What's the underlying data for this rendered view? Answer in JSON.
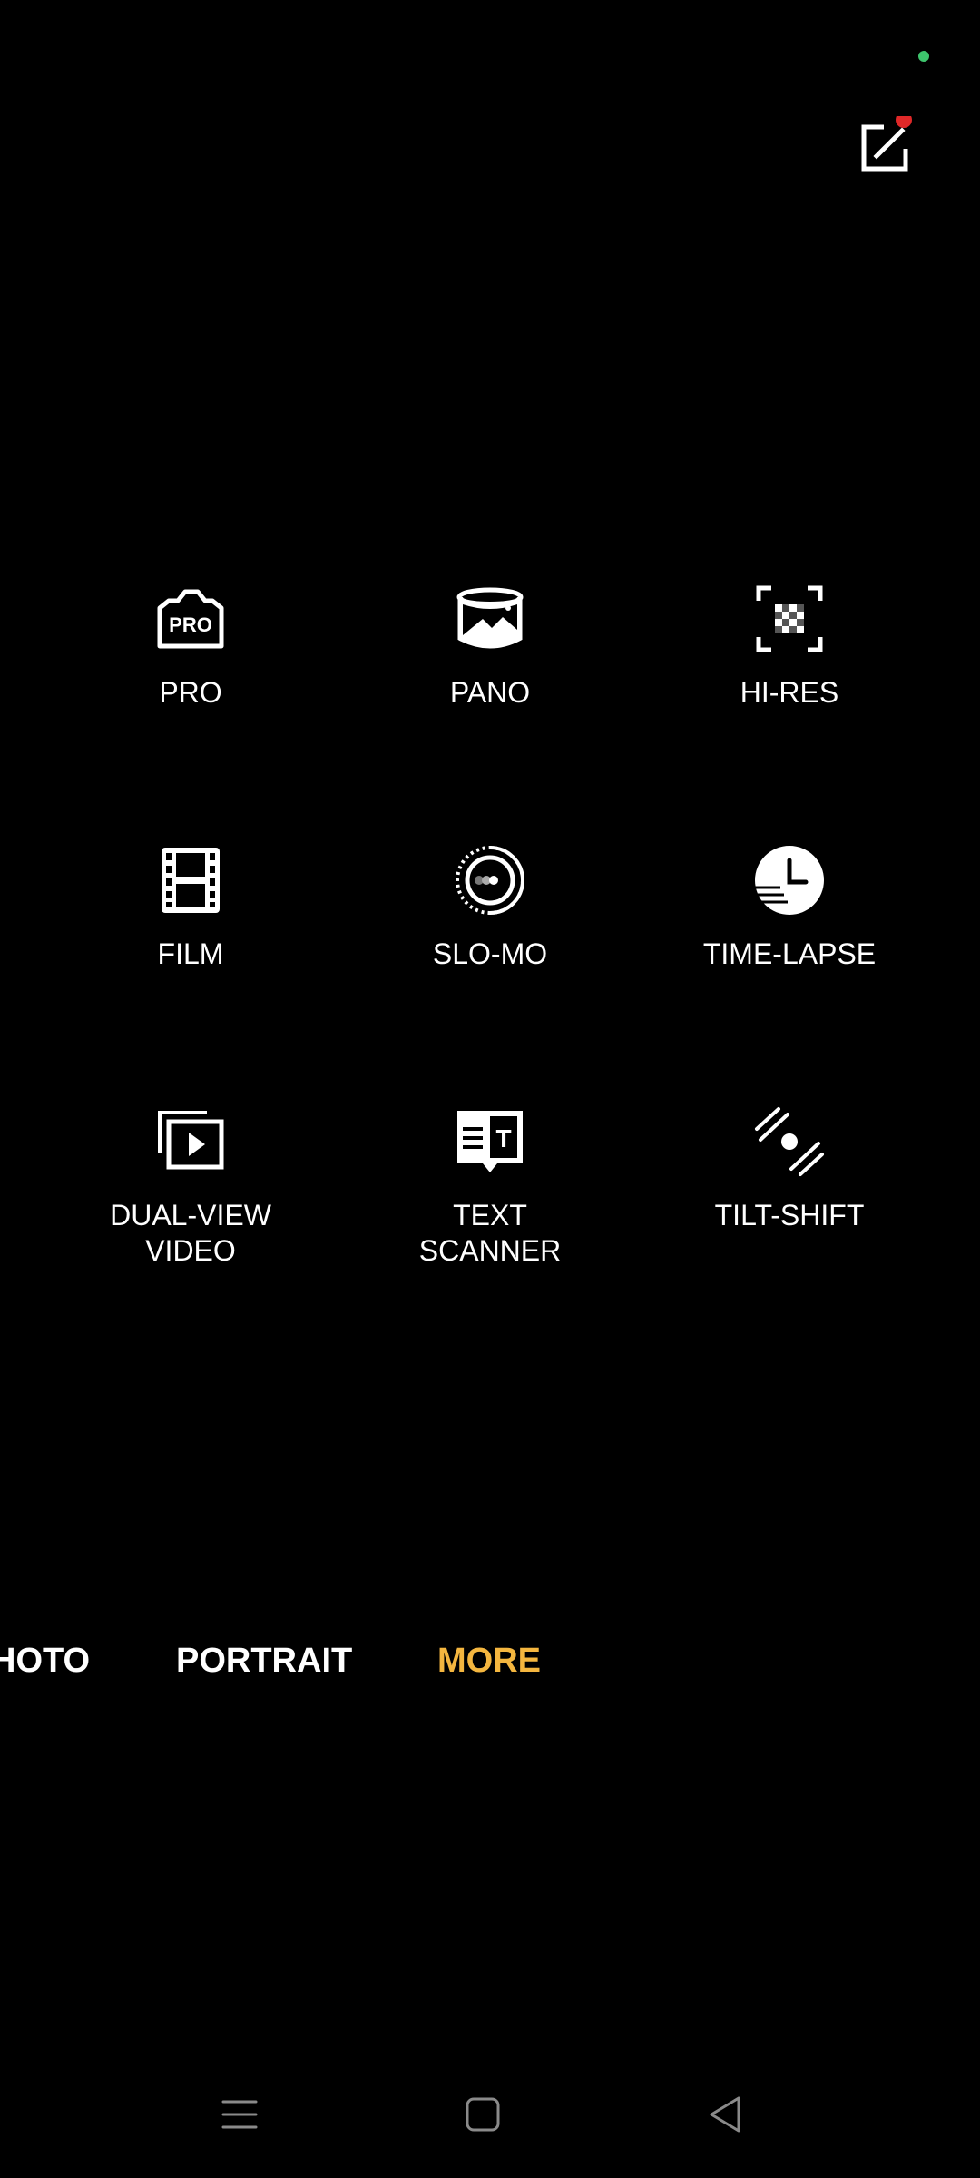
{
  "status": {
    "indicator_color": "#3ec46d"
  },
  "edit_button": {
    "icon": "edit-square-icon",
    "badge_color": "#e02828"
  },
  "modes": [
    {
      "label": "PRO",
      "icon": "pro-camera-icon"
    },
    {
      "label": "PANO",
      "icon": "panorama-icon"
    },
    {
      "label": "HI-RES",
      "icon": "hi-res-icon"
    },
    {
      "label": "FILM",
      "icon": "film-icon"
    },
    {
      "label": "SLO-MO",
      "icon": "slow-motion-icon"
    },
    {
      "label": "TIME-LAPSE",
      "icon": "time-lapse-icon"
    },
    {
      "label": "DUAL-VIEW\nVIDEO",
      "icon": "dual-view-video-icon"
    },
    {
      "label": "TEXT\nSCANNER",
      "icon": "text-scanner-icon"
    },
    {
      "label": "TILT-SHIFT",
      "icon": "tilt-shift-icon"
    }
  ],
  "mode_strip": {
    "items": [
      "HOTO",
      "PORTRAIT",
      "MORE"
    ],
    "active": "MORE",
    "active_color": "#f4b63f"
  },
  "nav_bar": {
    "buttons": [
      "menu-icon",
      "home-icon",
      "back-icon"
    ],
    "icon_color": "#8a8a8a"
  }
}
